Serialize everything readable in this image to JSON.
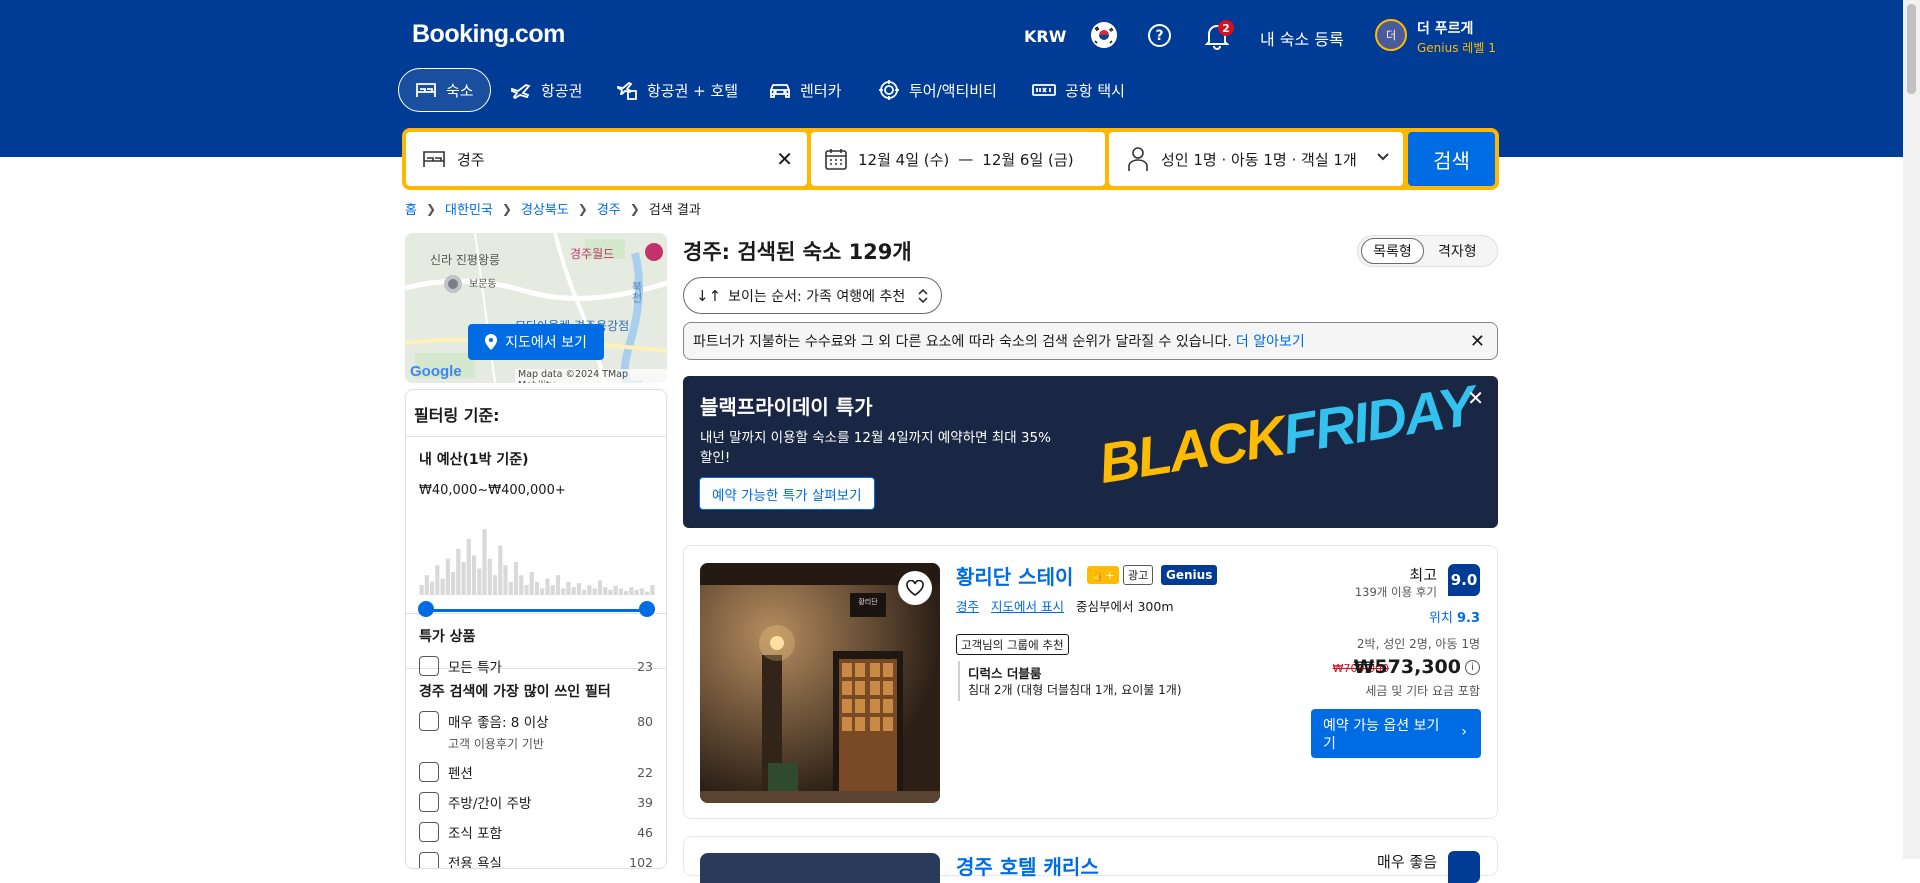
{
  "header": {
    "logo": "Booking.com",
    "currency": "KRW",
    "notif_count": "2",
    "list_property": "내 숙소 등록",
    "avatar_initial": "더",
    "user_name": "더 푸르게",
    "genius_level": "Genius 레벨 1",
    "nav": [
      {
        "label": "숙소",
        "icon": "bed-icon",
        "active": true
      },
      {
        "label": "항공권",
        "icon": "plane-icon"
      },
      {
        "label": "항공권 + 호텔",
        "icon": "plane-hotel-icon"
      },
      {
        "label": "렌터카",
        "icon": "car-icon"
      },
      {
        "label": "투어/액티비티",
        "icon": "attraction-icon"
      },
      {
        "label": "공항 택시",
        "icon": "taxi-icon"
      }
    ]
  },
  "search": {
    "destination": "경주",
    "checkin": "12월 4일 (수)",
    "date_sep": "—",
    "checkout": "12월 6일 (금)",
    "occupancy": "성인 1명 · 아동 1명 · 객실 1개",
    "button": "검색"
  },
  "breadcrumb": [
    "홈",
    "대한민국",
    "경상북도",
    "경주",
    "검색 결과"
  ],
  "map": {
    "label_silla": "신라 진평왕릉",
    "label_bomun": "보문동",
    "label_world": "경주월드",
    "label_river": "북천",
    "label_partial": "모다아울렛 경주용강점",
    "button": "지도에서 보기",
    "google": "Google",
    "attribution": "Map data ©2024 TMap Mobility"
  },
  "filters": {
    "title": "필터링 기준:",
    "budget_title": "내 예산(1박 기준)",
    "budget_range": "₩40,000~₩400,000+",
    "histogram": [
      0.15,
      0.3,
      0.2,
      0.45,
      0.25,
      0.55,
      0.35,
      0.7,
      0.5,
      0.85,
      0.6,
      0.4,
      1.0,
      0.55,
      0.3,
      0.75,
      0.45,
      0.2,
      0.5,
      0.3,
      0.15,
      0.35,
      0.2,
      0.1,
      0.25,
      0.15,
      0.3,
      0.1,
      0.2,
      0.12,
      0.18,
      0.08,
      0.15,
      0.1,
      0.22,
      0.12,
      0.08,
      0.14,
      0.1,
      0.06,
      0.12,
      0.08,
      0.1,
      0.05,
      0.15
    ],
    "deals_title": "특가 상품",
    "deals": [
      {
        "label": "모든 특가",
        "count": "23"
      }
    ],
    "popular_title": "경주 검색에 가장 많이 쓰인 필터",
    "popular": [
      {
        "label": "매우 좋음: 8 이상",
        "sub": "고객 이용후기 기반",
        "count": "80"
      },
      {
        "label": "펜션",
        "count": "22"
      },
      {
        "label": "주방/간이 주방",
        "count": "39"
      },
      {
        "label": "조식 포함",
        "count": "46"
      },
      {
        "label": "전용 욕실",
        "count": "102"
      }
    ]
  },
  "results": {
    "title": "경주: 검색된 숙소 129개",
    "view_list": "목록형",
    "view_grid": "격자형",
    "sort": "보이는 순서: 가족 여행에 추천",
    "notice": "파트너가 지불하는 수수료와 그 외 다른 요소에 따라 숙소의 검색 순위가 달라질 수 있습니다.",
    "notice_link": "더 알아보기"
  },
  "promo": {
    "title": "블랙프라이데이 특가",
    "desc1": "내년 말까지 이용할 숙소를 12월 4일까지 예약하면 최대 35%",
    "desc2": "할인!",
    "button": "예약 가능한 특가 살펴보기",
    "art_black": "BLACK",
    "art_friday": "FRIDAY"
  },
  "property": {
    "name": "황리단 스테이",
    "ad": "광고",
    "genius": "Genius",
    "city": "경주",
    "show_map": "지도에서 표시",
    "distance": "중심부에서 300m",
    "recommend": "고객님의 그룹에 추천",
    "room": "디럭스 더블룸",
    "beds": "침대 2개 (대형 더블침대 1개, 요이불 1개)",
    "sign_text": "황리단",
    "rating_word": "최고",
    "reviews": "139개 이용 후기",
    "score": "9.0",
    "location_label": "위치",
    "location_score": "9.3",
    "stay_info": "2박, 성인 2명, 아동 1명",
    "old_price": "₩700,000",
    "price": "₩573,300",
    "taxes": "세금 및 기타 요금 포함",
    "cta_line1": "예약 가능 옵션 보기",
    "cta_line2": "기"
  },
  "property2": {
    "name_partial": "경주 호텔 캐리스",
    "rating_partial": "매우 좋음"
  },
  "colors": {
    "brand": "#003b95",
    "accent": "#006ce4",
    "search_border": "#ffb700",
    "genius": "#febb02"
  }
}
